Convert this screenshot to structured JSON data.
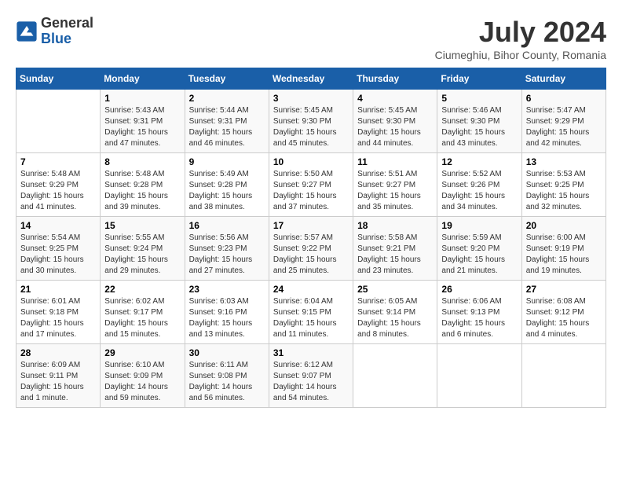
{
  "header": {
    "logo_general": "General",
    "logo_blue": "Blue",
    "month_title": "July 2024",
    "subtitle": "Ciumeghiu, Bihor County, Romania"
  },
  "weekdays": [
    "Sunday",
    "Monday",
    "Tuesday",
    "Wednesday",
    "Thursday",
    "Friday",
    "Saturday"
  ],
  "weeks": [
    [
      {
        "day": "",
        "sunrise": "",
        "sunset": "",
        "daylight": ""
      },
      {
        "day": "1",
        "sunrise": "Sunrise: 5:43 AM",
        "sunset": "Sunset: 9:31 PM",
        "daylight": "Daylight: 15 hours and 47 minutes."
      },
      {
        "day": "2",
        "sunrise": "Sunrise: 5:44 AM",
        "sunset": "Sunset: 9:31 PM",
        "daylight": "Daylight: 15 hours and 46 minutes."
      },
      {
        "day": "3",
        "sunrise": "Sunrise: 5:45 AM",
        "sunset": "Sunset: 9:30 PM",
        "daylight": "Daylight: 15 hours and 45 minutes."
      },
      {
        "day": "4",
        "sunrise": "Sunrise: 5:45 AM",
        "sunset": "Sunset: 9:30 PM",
        "daylight": "Daylight: 15 hours and 44 minutes."
      },
      {
        "day": "5",
        "sunrise": "Sunrise: 5:46 AM",
        "sunset": "Sunset: 9:30 PM",
        "daylight": "Daylight: 15 hours and 43 minutes."
      },
      {
        "day": "6",
        "sunrise": "Sunrise: 5:47 AM",
        "sunset": "Sunset: 9:29 PM",
        "daylight": "Daylight: 15 hours and 42 minutes."
      }
    ],
    [
      {
        "day": "7",
        "sunrise": "Sunrise: 5:48 AM",
        "sunset": "Sunset: 9:29 PM",
        "daylight": "Daylight: 15 hours and 41 minutes."
      },
      {
        "day": "8",
        "sunrise": "Sunrise: 5:48 AM",
        "sunset": "Sunset: 9:28 PM",
        "daylight": "Daylight: 15 hours and 39 minutes."
      },
      {
        "day": "9",
        "sunrise": "Sunrise: 5:49 AM",
        "sunset": "Sunset: 9:28 PM",
        "daylight": "Daylight: 15 hours and 38 minutes."
      },
      {
        "day": "10",
        "sunrise": "Sunrise: 5:50 AM",
        "sunset": "Sunset: 9:27 PM",
        "daylight": "Daylight: 15 hours and 37 minutes."
      },
      {
        "day": "11",
        "sunrise": "Sunrise: 5:51 AM",
        "sunset": "Sunset: 9:27 PM",
        "daylight": "Daylight: 15 hours and 35 minutes."
      },
      {
        "day": "12",
        "sunrise": "Sunrise: 5:52 AM",
        "sunset": "Sunset: 9:26 PM",
        "daylight": "Daylight: 15 hours and 34 minutes."
      },
      {
        "day": "13",
        "sunrise": "Sunrise: 5:53 AM",
        "sunset": "Sunset: 9:25 PM",
        "daylight": "Daylight: 15 hours and 32 minutes."
      }
    ],
    [
      {
        "day": "14",
        "sunrise": "Sunrise: 5:54 AM",
        "sunset": "Sunset: 9:25 PM",
        "daylight": "Daylight: 15 hours and 30 minutes."
      },
      {
        "day": "15",
        "sunrise": "Sunrise: 5:55 AM",
        "sunset": "Sunset: 9:24 PM",
        "daylight": "Daylight: 15 hours and 29 minutes."
      },
      {
        "day": "16",
        "sunrise": "Sunrise: 5:56 AM",
        "sunset": "Sunset: 9:23 PM",
        "daylight": "Daylight: 15 hours and 27 minutes."
      },
      {
        "day": "17",
        "sunrise": "Sunrise: 5:57 AM",
        "sunset": "Sunset: 9:22 PM",
        "daylight": "Daylight: 15 hours and 25 minutes."
      },
      {
        "day": "18",
        "sunrise": "Sunrise: 5:58 AM",
        "sunset": "Sunset: 9:21 PM",
        "daylight": "Daylight: 15 hours and 23 minutes."
      },
      {
        "day": "19",
        "sunrise": "Sunrise: 5:59 AM",
        "sunset": "Sunset: 9:20 PM",
        "daylight": "Daylight: 15 hours and 21 minutes."
      },
      {
        "day": "20",
        "sunrise": "Sunrise: 6:00 AM",
        "sunset": "Sunset: 9:19 PM",
        "daylight": "Daylight: 15 hours and 19 minutes."
      }
    ],
    [
      {
        "day": "21",
        "sunrise": "Sunrise: 6:01 AM",
        "sunset": "Sunset: 9:18 PM",
        "daylight": "Daylight: 15 hours and 17 minutes."
      },
      {
        "day": "22",
        "sunrise": "Sunrise: 6:02 AM",
        "sunset": "Sunset: 9:17 PM",
        "daylight": "Daylight: 15 hours and 15 minutes."
      },
      {
        "day": "23",
        "sunrise": "Sunrise: 6:03 AM",
        "sunset": "Sunset: 9:16 PM",
        "daylight": "Daylight: 15 hours and 13 minutes."
      },
      {
        "day": "24",
        "sunrise": "Sunrise: 6:04 AM",
        "sunset": "Sunset: 9:15 PM",
        "daylight": "Daylight: 15 hours and 11 minutes."
      },
      {
        "day": "25",
        "sunrise": "Sunrise: 6:05 AM",
        "sunset": "Sunset: 9:14 PM",
        "daylight": "Daylight: 15 hours and 8 minutes."
      },
      {
        "day": "26",
        "sunrise": "Sunrise: 6:06 AM",
        "sunset": "Sunset: 9:13 PM",
        "daylight": "Daylight: 15 hours and 6 minutes."
      },
      {
        "day": "27",
        "sunrise": "Sunrise: 6:08 AM",
        "sunset": "Sunset: 9:12 PM",
        "daylight": "Daylight: 15 hours and 4 minutes."
      }
    ],
    [
      {
        "day": "28",
        "sunrise": "Sunrise: 6:09 AM",
        "sunset": "Sunset: 9:11 PM",
        "daylight": "Daylight: 15 hours and 1 minute."
      },
      {
        "day": "29",
        "sunrise": "Sunrise: 6:10 AM",
        "sunset": "Sunset: 9:09 PM",
        "daylight": "Daylight: 14 hours and 59 minutes."
      },
      {
        "day": "30",
        "sunrise": "Sunrise: 6:11 AM",
        "sunset": "Sunset: 9:08 PM",
        "daylight": "Daylight: 14 hours and 56 minutes."
      },
      {
        "day": "31",
        "sunrise": "Sunrise: 6:12 AM",
        "sunset": "Sunset: 9:07 PM",
        "daylight": "Daylight: 14 hours and 54 minutes."
      },
      {
        "day": "",
        "sunrise": "",
        "sunset": "",
        "daylight": ""
      },
      {
        "day": "",
        "sunrise": "",
        "sunset": "",
        "daylight": ""
      },
      {
        "day": "",
        "sunrise": "",
        "sunset": "",
        "daylight": ""
      }
    ]
  ]
}
